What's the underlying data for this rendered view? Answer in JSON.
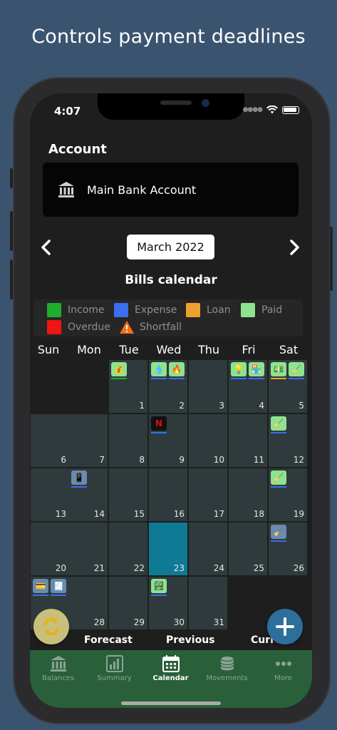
{
  "headline": "Controls payment deadlines",
  "status": {
    "time": "4:07"
  },
  "account": {
    "label": "Account",
    "name": "Main Bank Account"
  },
  "calendar": {
    "month": "March 2022",
    "title": "Bills calendar",
    "today": 23
  },
  "legend": [
    {
      "label": "Income",
      "color": "#1fae2c"
    },
    {
      "label": "Expense",
      "color": "#3c6ef0"
    },
    {
      "label": "Loan",
      "color": "#f0a030"
    },
    {
      "label": "Paid",
      "color": "#8ee38e"
    },
    {
      "label": "Overdue",
      "color": "#f01414"
    },
    {
      "label": "Shortfall",
      "color": "#f07020"
    }
  ],
  "weekdays": [
    "Sun",
    "Mon",
    "Tue",
    "Wed",
    "Thu",
    "Fri",
    "Sat"
  ],
  "days": [
    {
      "day": 1,
      "bills": [
        {
          "icon": "money-bag-icon",
          "glyph": "💰",
          "status": "income"
        }
      ]
    },
    {
      "day": 2,
      "bills": [
        {
          "icon": "water-drop-icon",
          "glyph": "💧",
          "status": "expense"
        },
        {
          "icon": "gas-flame-icon",
          "glyph": "🔥",
          "status": "expense"
        }
      ]
    },
    {
      "day": 4,
      "bills": [
        {
          "icon": "lightbulb-icon",
          "glyph": "💡",
          "status": "expense"
        },
        {
          "icon": "store-icon",
          "glyph": "🏪",
          "status": "expense"
        }
      ]
    },
    {
      "day": 5,
      "bills": [
        {
          "icon": "hand-money-icon",
          "glyph": "💵",
          "status": "loan"
        },
        {
          "icon": "broom-icon",
          "glyph": "🧹",
          "status": "expense"
        }
      ]
    },
    {
      "day": 9,
      "bills": [
        {
          "icon": "netflix-icon",
          "glyph": "N",
          "status": "expense"
        }
      ]
    },
    {
      "day": 12,
      "bills": [
        {
          "icon": "broom-icon",
          "glyph": "🧹",
          "status": "expense"
        }
      ]
    },
    {
      "day": 14,
      "bills": [
        {
          "icon": "phone-shortfall-icon",
          "glyph": "📱",
          "status": "expense"
        }
      ]
    },
    {
      "day": 19,
      "bills": [
        {
          "icon": "broom-icon",
          "glyph": "🧹",
          "status": "expense"
        }
      ]
    },
    {
      "day": 26,
      "bills": [
        {
          "icon": "broom-shortfall-icon",
          "glyph": "🧹",
          "status": "expense"
        }
      ]
    },
    {
      "day": 27,
      "bills": [
        {
          "icon": "card-shortfall-icon",
          "glyph": "💳",
          "status": "expense"
        },
        {
          "icon": "receipt-shortfall-icon",
          "glyph": "🧾",
          "status": "expense"
        }
      ]
    },
    {
      "day": 30,
      "bills": [
        {
          "icon": "landscape-icon",
          "glyph": "🏞",
          "status": "expense"
        }
      ]
    }
  ],
  "segments": [
    "Forecast",
    "Previous",
    "Current"
  ],
  "tabs": [
    {
      "label": "Balances",
      "icon": "bank-icon"
    },
    {
      "label": "Summary",
      "icon": "summary-chart-icon"
    },
    {
      "label": "Calendar",
      "icon": "calendar-icon",
      "active": true
    },
    {
      "label": "Movements",
      "icon": "coins-icon"
    },
    {
      "label": "More",
      "icon": "more-dots-icon"
    }
  ],
  "colors": {
    "accent": "#0e7a94",
    "tabbar": "#29603a",
    "income": "#1fae2c",
    "expense": "#3c6ef0",
    "loan": "#f0a030"
  }
}
